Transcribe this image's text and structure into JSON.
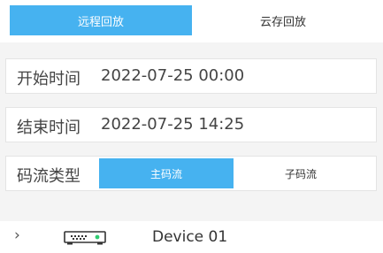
{
  "tabs": [
    {
      "label": "远程回放",
      "active": true
    },
    {
      "label": "云存回放",
      "active": false
    }
  ],
  "start_time": {
    "label": "开始时间",
    "value": "2022-07-25 00:00"
  },
  "end_time": {
    "label": "结束时间",
    "value": "2022-07-25 14:25"
  },
  "stream_type": {
    "label": "码流类型",
    "options": [
      {
        "label": "主码流",
        "selected": true
      },
      {
        "label": "子码流",
        "selected": false
      }
    ]
  },
  "device": {
    "name": "Device 01",
    "icon": "nvr-device-icon"
  },
  "colors": {
    "accent": "#46b2f0",
    "device_led": "#2ecc71"
  }
}
